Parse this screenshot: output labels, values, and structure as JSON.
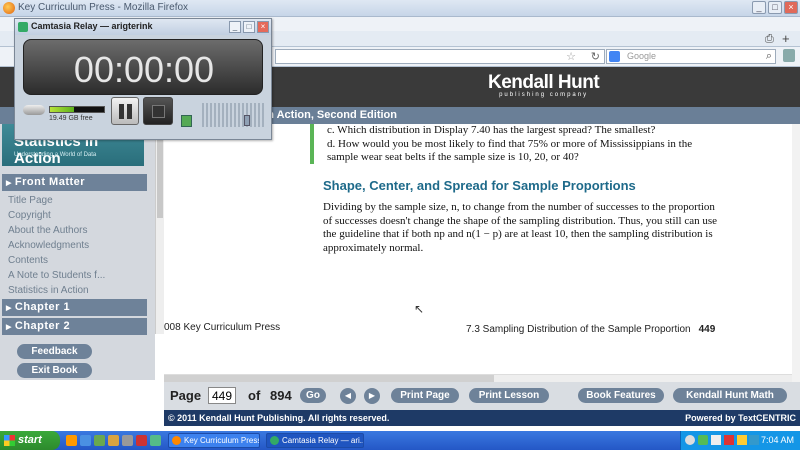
{
  "firefox": {
    "window_title": "Key Curriculum Press - Mozilla Firefox",
    "search_placeholder": "Google"
  },
  "brand": {
    "logo": "Kendall Hunt",
    "logo_sub": "publishing company"
  },
  "book_title": "s in Action, Second Edition",
  "sidebar": {
    "cover_title": "Statistics in Action",
    "cover_sub": "Understanding a World of Data",
    "front_matter": "Front Matter",
    "links": [
      "Title Page",
      "Copyright",
      "About the Authors",
      "Acknowledgments",
      "Contents",
      "A Note to Students f...",
      "Statistics in Action"
    ],
    "chapter1": "Chapter 1",
    "chapter2": "Chapter 2",
    "feedback": "Feedback",
    "exit": "Exit Book"
  },
  "content": {
    "q_c": "c.  Which distribution in Display 7.40 has the largest spread? The smallest?",
    "q_d": "d.  How would you be most likely to find that 75% or more of Mississippians in the sample wear seat belts if the sample size is 10, 20, or 40?",
    "heading": "Shape, Center, and Spread for Sample Proportions",
    "para": "Dividing by the sample size, n, to change from the number of successes to the proportion of successes doesn't change the shape of the sampling distribution. Thus, you still can use the guideline that if both np and n(1 − p) are at least 10, then the sampling distribution is approximately normal.",
    "footer_left": "008 Key Curriculum Press",
    "footer_right": "7.3  Sampling Distribution of the Sample Proportion",
    "footer_page": "449"
  },
  "navbar": {
    "page_label": "Page",
    "page_value": "449",
    "of_label": "of",
    "total_pages": "894",
    "go": "Go",
    "print_page": "Print Page",
    "print_lesson": "Print Lesson",
    "book_features": "Book Features",
    "kh_math": "Kendall Hunt Math"
  },
  "copyright": "© 2011 Kendall Hunt Publishing. All rights reserved.",
  "powered": "Powered by TextCENTRIC",
  "camtasia": {
    "title": "Camtasia Relay — arigterink",
    "timer": "00:00:00",
    "free_space": "19.49 GB free",
    "level": 0.45
  },
  "taskbar": {
    "start": "start",
    "tasks": [
      "Key Curriculum Press ...",
      "Camtasia Relay — ari..."
    ],
    "clock": "7:04 AM"
  }
}
